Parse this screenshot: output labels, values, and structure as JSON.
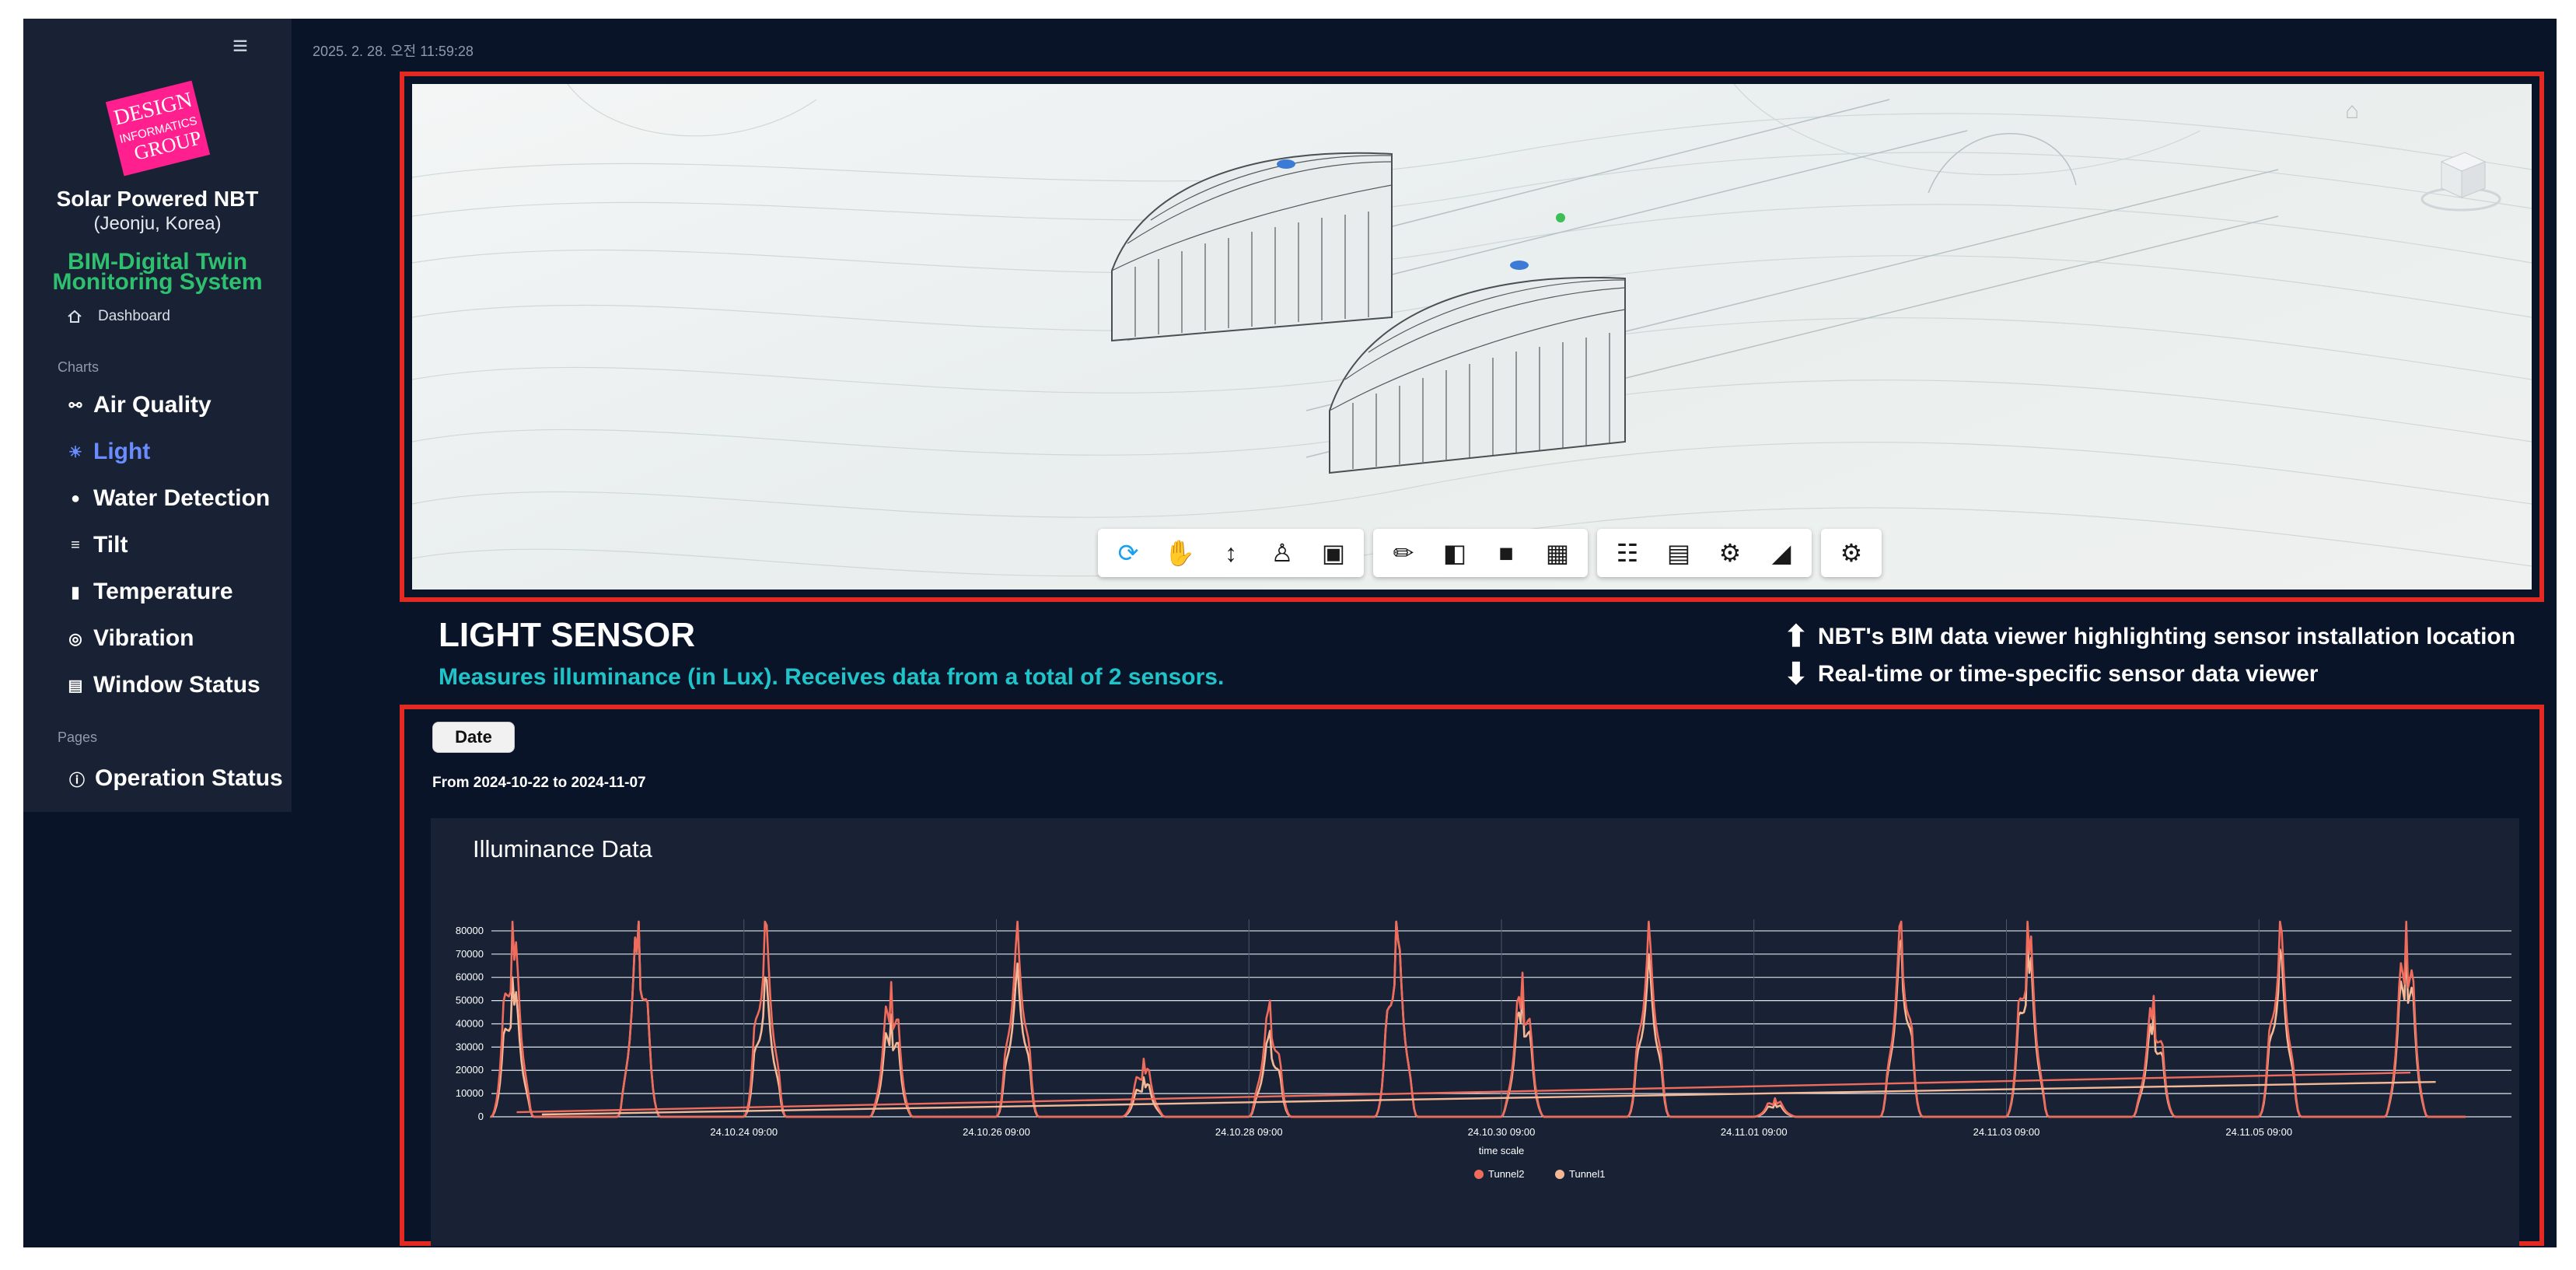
{
  "header": {
    "timestamp": "2025. 2. 28. 오전 11:59:28",
    "menu_icon": "hamburger-icon"
  },
  "sidebar": {
    "logo_lines": [
      "DESIGN",
      "INFORMATICS",
      "GROUP"
    ],
    "app_name": "Solar Powered NBT",
    "app_location": "(Jeonju, Korea)",
    "system_title_1": "BIM-Digital Twin",
    "system_title_2": "Monitoring System",
    "dashboard_label": "Dashboard",
    "charts_label": "Charts",
    "pages_label": "Pages",
    "chart_items": [
      {
        "label": "Air Quality",
        "icon": "air-quality-icon"
      },
      {
        "label": "Light",
        "icon": "sun-icon",
        "active": true
      },
      {
        "label": "Water Detection",
        "icon": "water-drop-icon"
      },
      {
        "label": "Tilt",
        "icon": "tilt-icon"
      },
      {
        "label": "Temperature",
        "icon": "thermometer-icon"
      },
      {
        "label": "Vibration",
        "icon": "vibration-icon"
      },
      {
        "label": "Window Status",
        "icon": "window-icon"
      }
    ],
    "page_items": [
      {
        "label": "Operation Status",
        "icon": "help-circle-icon"
      }
    ],
    "active_color": "#6b8cff",
    "system_title_color": "#2fc06f"
  },
  "viewer": {
    "toolbar_groups": [
      [
        "orbit-icon",
        "pan-icon",
        "zoom-icon",
        "first-person-icon",
        "camera-icon"
      ],
      [
        "measure-icon",
        "section-icon",
        "explode-icon",
        "model-browser-icon"
      ],
      [
        "structure-icon",
        "properties-icon",
        "settings-icon",
        "fullscreen-icon"
      ],
      [
        "robot-extension-icon"
      ]
    ]
  },
  "sensor": {
    "title": "LIGHT SENSOR",
    "description": "Measures illuminance (in Lux). Receives data from a total of 2 sensors.",
    "note_up": "NBT's BIM data viewer highlighting sensor installation location",
    "note_down": "Real-time or time-specific sensor data viewer",
    "accent_color": "#1fc4c9",
    "frame_color": "#e32a22"
  },
  "data_panel": {
    "date_button": "Date",
    "range_text": "From 2024-10-22 to 2024-11-07"
  },
  "chart_data": {
    "type": "line",
    "title": "Illuminance Data",
    "xlabel": "time scale",
    "ylabel": "",
    "ylim": [
      0,
      85000
    ],
    "yticks": [
      0,
      10000,
      20000,
      30000,
      40000,
      50000,
      60000,
      70000,
      80000
    ],
    "xticks": [
      "24.10.24 09:00",
      "24.10.26 09:00",
      "24.10.28 09:00",
      "24.10.30 09:00",
      "24.11.01 09:00",
      "24.11.03 09:00",
      "24.11.05 09:00"
    ],
    "x_start": "24.10.22 09:00",
    "x_end": "24.11.07 09:00",
    "legend_position": "bottom-center",
    "grid": true,
    "daily_peak_time": "13:00",
    "daily_peaks": [
      {
        "date": "24.10.22",
        "Tunnel2": 84000,
        "Tunnel1": 60000
      },
      {
        "date": "24.10.23",
        "Tunnel2": 84000,
        "Tunnel1": 84000
      },
      {
        "date": "24.10.24",
        "Tunnel2": 84000,
        "Tunnel1": 60000
      },
      {
        "date": "24.10.25",
        "Tunnel2": 58000,
        "Tunnel1": 44000
      },
      {
        "date": "24.10.26",
        "Tunnel2": 84000,
        "Tunnel1": 66000
      },
      {
        "date": "24.10.27",
        "Tunnel2": 25000,
        "Tunnel1": 17000
      },
      {
        "date": "24.10.28",
        "Tunnel2": 50000,
        "Tunnel1": 37000
      },
      {
        "date": "24.10.29",
        "Tunnel2": 84000,
        "Tunnel1": 84000
      },
      {
        "date": "24.10.30",
        "Tunnel2": 62000,
        "Tunnel1": 54000
      },
      {
        "date": "24.10.31",
        "Tunnel2": 84000,
        "Tunnel1": 70000
      },
      {
        "date": "24.11.01",
        "Tunnel2": 8000,
        "Tunnel1": 6000
      },
      {
        "date": "24.11.02",
        "Tunnel2": 84000,
        "Tunnel1": 76000
      },
      {
        "date": "24.11.03",
        "Tunnel2": 84000,
        "Tunnel1": 74000
      },
      {
        "date": "24.11.04",
        "Tunnel2": 52000,
        "Tunnel1": 44000
      },
      {
        "date": "24.11.05",
        "Tunnel2": 84000,
        "Tunnel1": 72000
      },
      {
        "date": "24.11.06",
        "Tunnel2": 84000,
        "Tunnel1": 74000
      }
    ],
    "series": [
      {
        "name": "Tunnel2",
        "color": "#ef6b5b"
      },
      {
        "name": "Tunnel1",
        "color": "#f4b896"
      }
    ]
  }
}
